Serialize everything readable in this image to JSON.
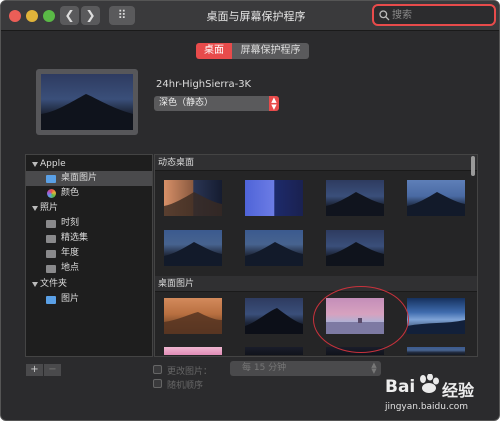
{
  "window": {
    "title": "桌面与屏幕保护程序"
  },
  "toolbar": {
    "back_label": "❮",
    "forward_label": "❯",
    "grid_label": "⠿"
  },
  "search": {
    "placeholder": "搜索"
  },
  "tabs": [
    {
      "label": "桌面",
      "selected": true
    },
    {
      "label": "屏幕保护程序",
      "selected": false
    }
  ],
  "current": {
    "name": "24hr-HighSierra-3K",
    "mode": "深色（静态）"
  },
  "sidebar": {
    "groups": [
      {
        "label": "Apple",
        "items": [
          {
            "label": "桌面图片",
            "selected": true
          },
          {
            "label": "颜色",
            "selected": false
          }
        ]
      },
      {
        "label": "照片",
        "items": [
          {
            "label": "时刻"
          },
          {
            "label": "精选集"
          },
          {
            "label": "年度"
          },
          {
            "label": "地点"
          }
        ]
      },
      {
        "label": "文件夹",
        "items": [
          {
            "label": "图片"
          }
        ]
      }
    ]
  },
  "gallery": {
    "sections": [
      {
        "title": "动态桌面"
      },
      {
        "title": "桌面图片"
      }
    ]
  },
  "footer": {
    "add_label": "+",
    "remove_label": "−",
    "change_picture_label": "更改图片：",
    "interval_value": "每 15 分钟",
    "random_order_label": "随机顺序"
  },
  "watermark": {
    "logo_text": "Bai",
    "logo_suffix": "经验",
    "url": "jingyan.baidu.com"
  },
  "colors": {
    "accent": "#e84b4b",
    "window_bg": "#2b2b2d",
    "selection": "#5a5a5c"
  }
}
